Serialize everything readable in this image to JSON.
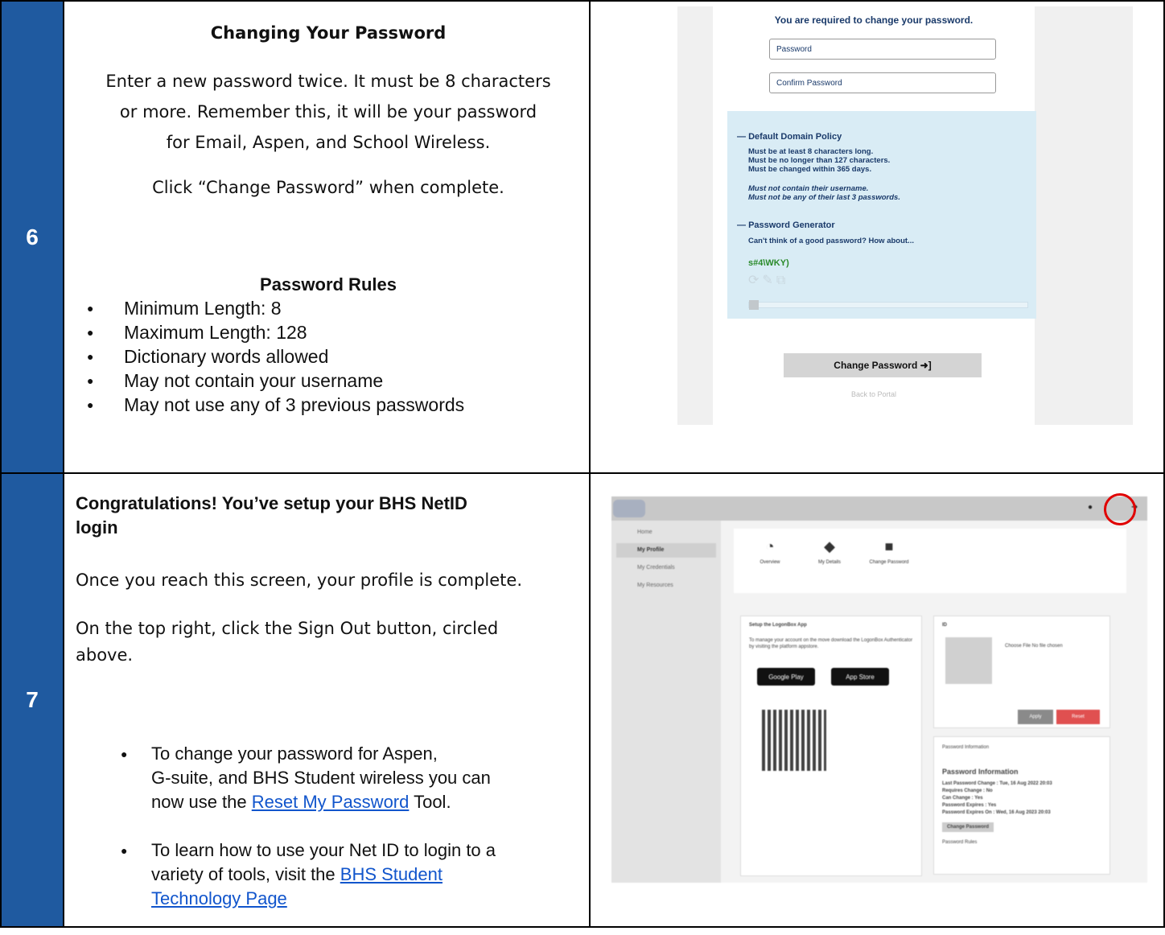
{
  "step6": {
    "number": "6",
    "title": "Changing Your Password",
    "para1_lines": [
      "Enter a new password twice. It must be 8 characters",
      "or more.  Remember this, it will be your password",
      "for Email, Aspen, and School Wireless."
    ],
    "para2": "Click “Change Password” when complete.",
    "rules_title": "Password Rules",
    "rules": [
      "Minimum Length: 8",
      "Maximum Length:  128",
      "Dictionary words allowed",
      "May not contain your username",
      "May not use any of 3 previous passwords"
    ],
    "screenshot": {
      "heading": "You are required to change your password.",
      "password_placeholder": "Password",
      "confirm_placeholder": "Confirm Password",
      "policy_section": "Default Domain Policy",
      "policy_lines": [
        "Must be at least 8 characters long.",
        "Must be no longer than 127 characters.",
        "Must be changed within 365 days."
      ],
      "policy_italic": [
        "Must not contain their username.",
        "Must not be any of their last 3 passwords."
      ],
      "generator_section": "Password Generator",
      "generator_prompt": "Can't think of a good password? How about...",
      "generated": "s#4\\WKY)",
      "button": "Change Password ➜]",
      "back": "Back to Portal"
    }
  },
  "step7": {
    "number": "7",
    "title_lines": [
      "Congratulations! You’ve setup your BHS NetID",
      "login"
    ],
    "para1": "Once you reach this screen, your profile is complete.",
    "para2_lines": [
      "On the top right, click the Sign Out button, circled",
      "above."
    ],
    "bullet1_pre": [
      "To change your password for Aspen,",
      "G-suite, and BHS Student wireless you can",
      "now use the "
    ],
    "bullet1_link": "Reset My Password",
    "bullet1_post": " Tool.",
    "bullet2_pre": [
      "To learn how to use your Net ID to login to a",
      "variety of tools, visit the "
    ],
    "bullet2_link_lines": [
      "BHS Student",
      "Technology Page"
    ],
    "screenshot": {
      "side_items": [
        "Home",
        "My Profile",
        "My Credentials",
        "My Resources"
      ],
      "tabs": [
        "Overview",
        "My Details",
        "Change Password"
      ],
      "card1_title": "Setup the LogonBox App",
      "card1_text": "To manage your account on the move download the LogonBox Authenticator by visiting the platform appstore.",
      "google_play": "Google Play",
      "app_store": "App Store",
      "card2_title": "ID",
      "choose_file": "Choose File  No file chosen",
      "apply": "Apply",
      "reset": "Reset",
      "pw_info_header": "Password Information",
      "pw_info_title": "Password Information",
      "pw_rows": [
        [
          "Last Password Change :",
          "Tue, 16 Aug 2022 20:03"
        ],
        [
          "Requires Change :",
          "No"
        ],
        [
          "Can Change :",
          "Yes"
        ],
        [
          "Password Expires :",
          "Yes"
        ],
        [
          "Password Expires On :",
          "Wed, 16 Aug 2023 20:03"
        ]
      ],
      "change_btn": "Change Password",
      "pw_rules": "Password Rules"
    }
  },
  "colors": {
    "number_band": "#1f5aa0",
    "link": "#1155cc",
    "circle": "#e00000"
  }
}
